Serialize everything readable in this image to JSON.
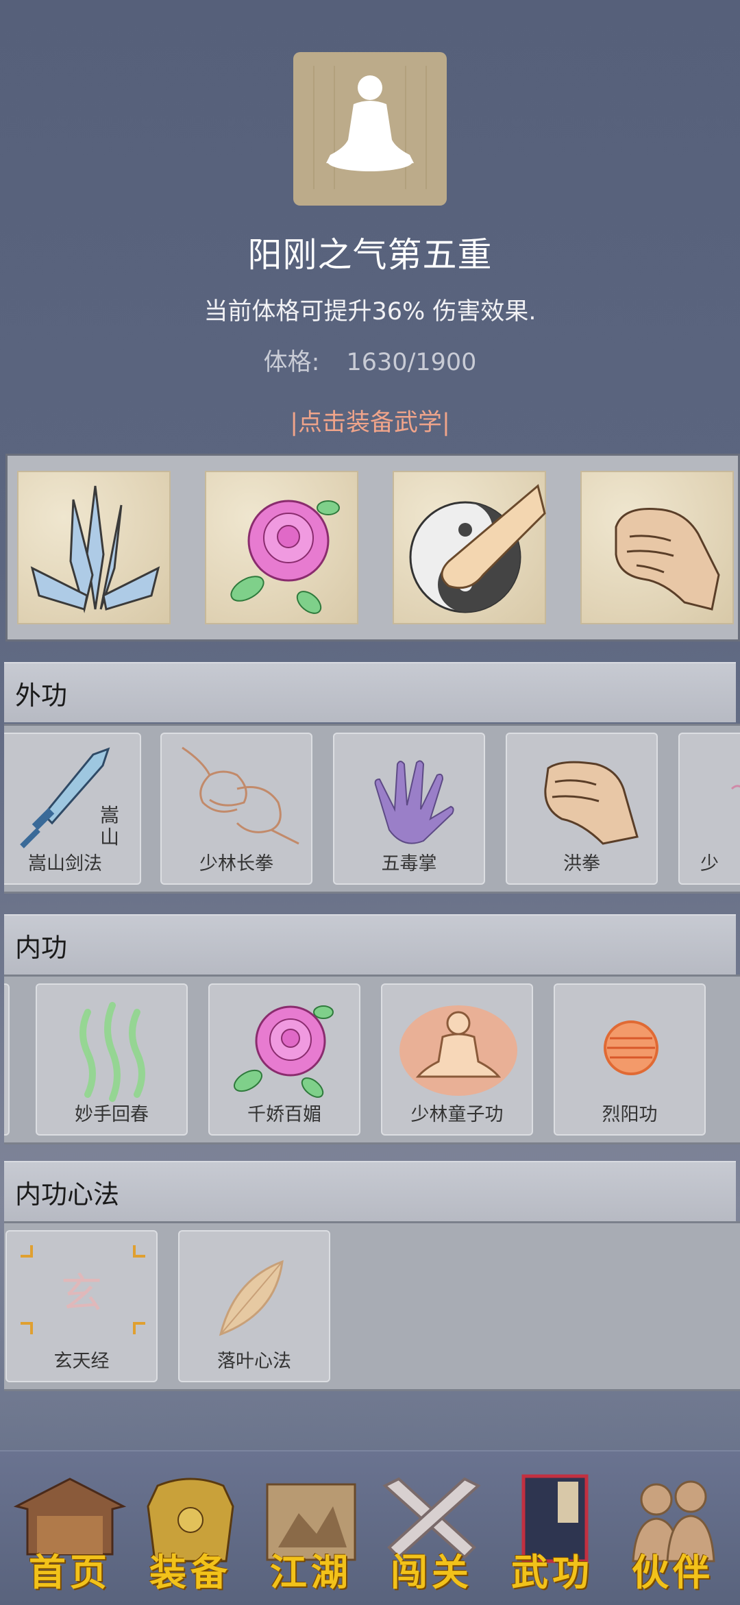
{
  "header": {
    "icon": "meditation-icon",
    "title": "阳刚之气第五重",
    "description": "当前体格可提升36% 伤害效果.",
    "stat_label": "体格:",
    "stat_value": "1630/1900",
    "equip_link": "|点击装备武学|"
  },
  "equipped": [
    {
      "icon": "crystal-swords-icon"
    },
    {
      "icon": "rose-icon"
    },
    {
      "icon": "yin-yang-fist-icon"
    },
    {
      "icon": "fist-icon"
    }
  ],
  "sections": {
    "external": {
      "title": "外功",
      "skills": [
        {
          "label": "嵩山剑法",
          "icon": "sword-icon"
        },
        {
          "label": "少林长拳",
          "icon": "fists-icon"
        },
        {
          "label": "五毒掌",
          "icon": "purple-palm-icon"
        },
        {
          "label": "洪拳",
          "icon": "fist-icon"
        },
        {
          "label": "少",
          "icon": "partial-icon"
        }
      ]
    },
    "internal": {
      "title": "内功",
      "skills": [
        {
          "label": "妙手回春",
          "icon": "green-waves-icon"
        },
        {
          "label": "千娇百媚",
          "icon": "rose-icon"
        },
        {
          "label": "少林童子功",
          "icon": "meditating-monk-icon"
        },
        {
          "label": "烈阳功",
          "icon": "sun-orb-icon"
        }
      ]
    },
    "mental": {
      "title": "内功心法",
      "skills": [
        {
          "label": "玄天经",
          "icon": "xuan-seal-icon",
          "glyph": "玄"
        },
        {
          "label": "落叶心法",
          "icon": "leaf-icon"
        }
      ]
    }
  },
  "tabs": [
    {
      "label": "首页",
      "icon": "house-icon"
    },
    {
      "label": "装备",
      "icon": "armor-icon"
    },
    {
      "label": "江湖",
      "icon": "scroll-map-icon"
    },
    {
      "label": "闯关",
      "icon": "crossed-swords-icon"
    },
    {
      "label": "武功",
      "icon": "book-icon",
      "active": true
    },
    {
      "label": "伙伴",
      "icon": "companions-icon"
    }
  ],
  "colors": {
    "accent_link": "#f0a48a",
    "tab_label": "#f2c21a"
  }
}
